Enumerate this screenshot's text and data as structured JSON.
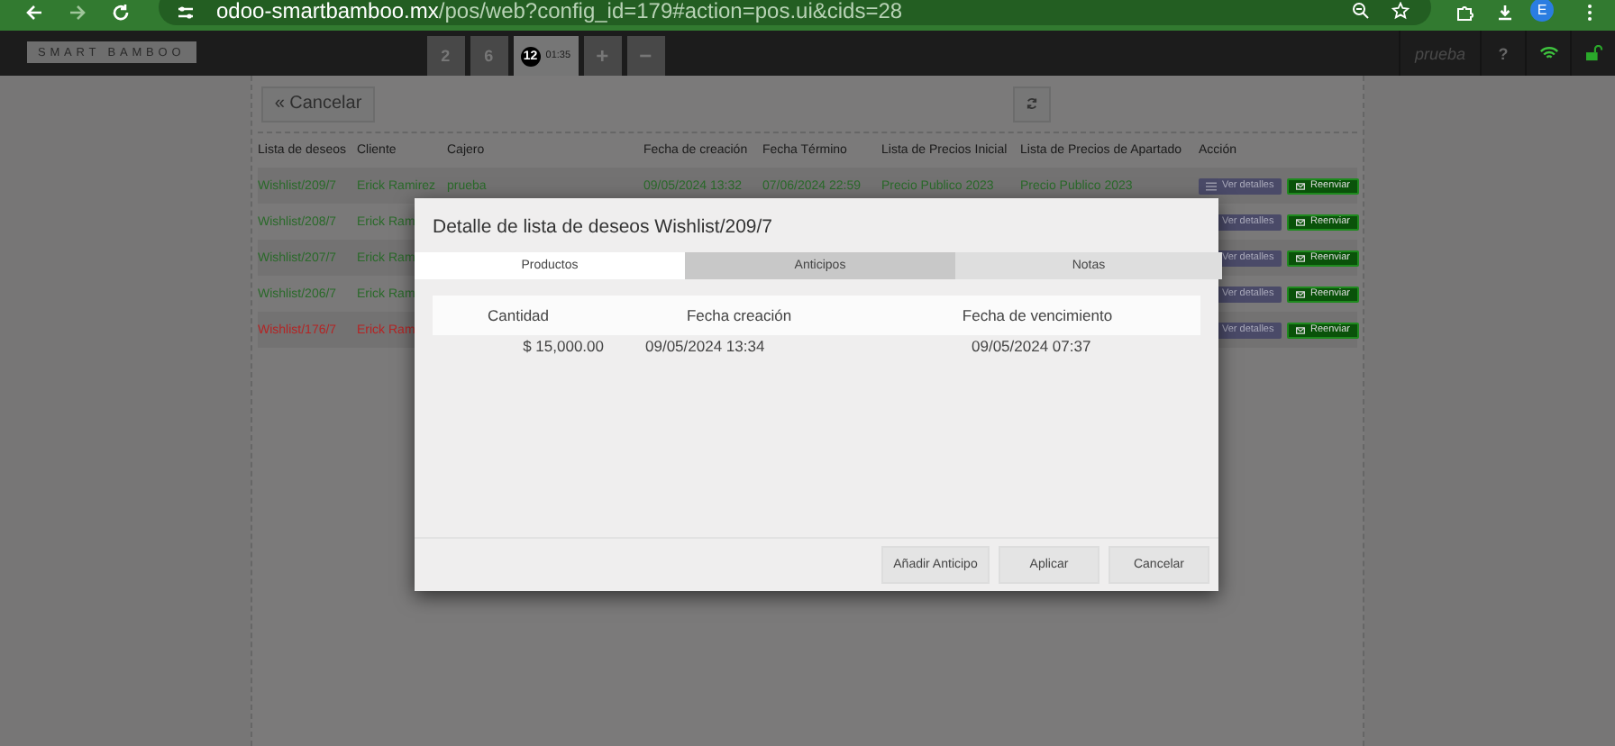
{
  "browser": {
    "url_host": "odoo-smartbamboo.mx",
    "url_path": "/pos/web?config_id=179#action=pos.ui&cids=28",
    "profile": "E"
  },
  "header": {
    "logo": "SMART BAMBOO",
    "orders": [
      {
        "label": "2",
        "selected": false
      },
      {
        "label": "6",
        "selected": false
      },
      {
        "label": "12",
        "time": "01:35",
        "selected": true
      }
    ],
    "add": "+",
    "remove": "−",
    "user": "prueba",
    "help": "?"
  },
  "back_button": "« Cancelar",
  "table": {
    "columns": [
      "Lista de deseos",
      "Cliente",
      "Cajero",
      "Fecha de creación",
      "Fecha Término",
      "Lista de Precios Inicial",
      "Lista de Precios de Apartado",
      "Acción"
    ],
    "rows": [
      {
        "cells": [
          "Wishlist/209/7",
          "Erick Ramirez",
          "prueba",
          "09/05/2024 13:32",
          "07/06/2024 22:59",
          "Precio Publico 2023",
          "Precio Publico 2023"
        ],
        "color": "#2a6a2a",
        "details": "Ver detalles",
        "resend": "Reenviar"
      },
      {
        "cells": [
          "Wishlist/208/7",
          "Erick Ram"
        ],
        "color": "#2a6a2a",
        "details": "Ver detalles",
        "resend": "Reenviar"
      },
      {
        "cells": [
          "Wishlist/207/7",
          "Erick Ram"
        ],
        "color": "#2a6a2a",
        "details": "Ver detalles",
        "resend": "Reenviar"
      },
      {
        "cells": [
          "Wishlist/206/7",
          "Erick Ram"
        ],
        "color": "#2a6a2a",
        "details": "Ver detalles",
        "resend": "Reenviar"
      },
      {
        "cells": [
          "Wishlist/176/7",
          "Erick Ram"
        ],
        "color": "#b52424",
        "details": "Ver detalles",
        "resend": "Reenviar"
      }
    ]
  },
  "modal": {
    "title": "Detalle de lista de deseos Wishlist/209/7",
    "tabs": [
      {
        "label": "Productos",
        "selected": true,
        "highlighted": false
      },
      {
        "label": "Anticipos",
        "selected": false,
        "highlighted": true
      },
      {
        "label": "Notas",
        "selected": false,
        "highlighted": false
      }
    ],
    "columns": [
      "Cantidad",
      "Fecha creación",
      "Fecha de vencimiento"
    ],
    "rows": [
      [
        "$ 15,000.00",
        "09/05/2024 13:34",
        "09/05/2024 07:37"
      ]
    ],
    "buttons": [
      "Añadir Anticipo",
      "Aplicar",
      "Cancelar"
    ]
  }
}
